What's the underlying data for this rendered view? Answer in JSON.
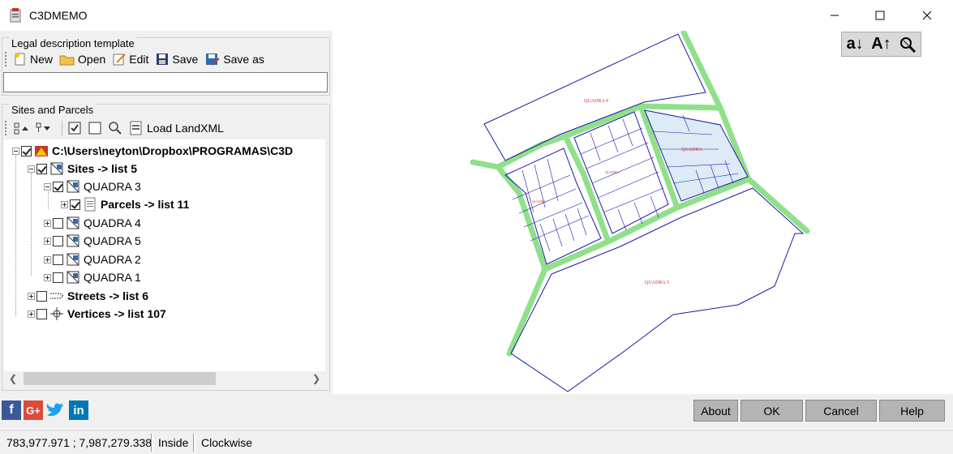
{
  "window": {
    "title": "C3DMEMO"
  },
  "template_panel": {
    "legend": "Legal description template",
    "toolbar": {
      "new_label": "New",
      "open_label": "Open",
      "edit_label": "Edit",
      "save_label": "Save",
      "save_as_label": "Save as"
    },
    "input_value": ""
  },
  "sites_panel": {
    "legend": "Sites and Parcels",
    "toolbar": {
      "load_label": "Load LandXML"
    },
    "tree": {
      "root": "C:\\Users\\neyton\\Dropbox\\PROGRAMAS\\C3D",
      "sites": "Sites -> list 5",
      "quadra3": "QUADRA 3",
      "parcels": "Parcels -> list 11",
      "quadra4": "QUADRA 4",
      "quadra5": "QUADRA 5",
      "quadra2": "QUADRA 2",
      "quadra1": "QUADRA 1",
      "streets": "Streets -> list 6",
      "vertices": "Vertices -> list 107"
    }
  },
  "map_tools": {
    "tool1": "a↓",
    "tool2": "A↑"
  },
  "map_labels": {
    "quadra_top": "QUADRA 4",
    "quadra_bottom": "QUADRA 5"
  },
  "buttons": {
    "about": "About",
    "ok": "OK",
    "cancel": "Cancel",
    "help": "Help"
  },
  "social": {
    "facebook": "f",
    "google": "G+",
    "linkedin": "in"
  },
  "status": {
    "coords": "783,977.971 ; 7,987,279.338",
    "inside": "Inside",
    "direction": "Clockwise"
  },
  "colors": {
    "street": "#90e08a",
    "parcel_line": "#1a1aa6",
    "selected_fill": "#dcebf5",
    "button": "#b4b4b4",
    "facebook": "#3b5998",
    "google": "#dd4b39",
    "twitter": "#1da1f2",
    "linkedin": "#0077b5"
  }
}
